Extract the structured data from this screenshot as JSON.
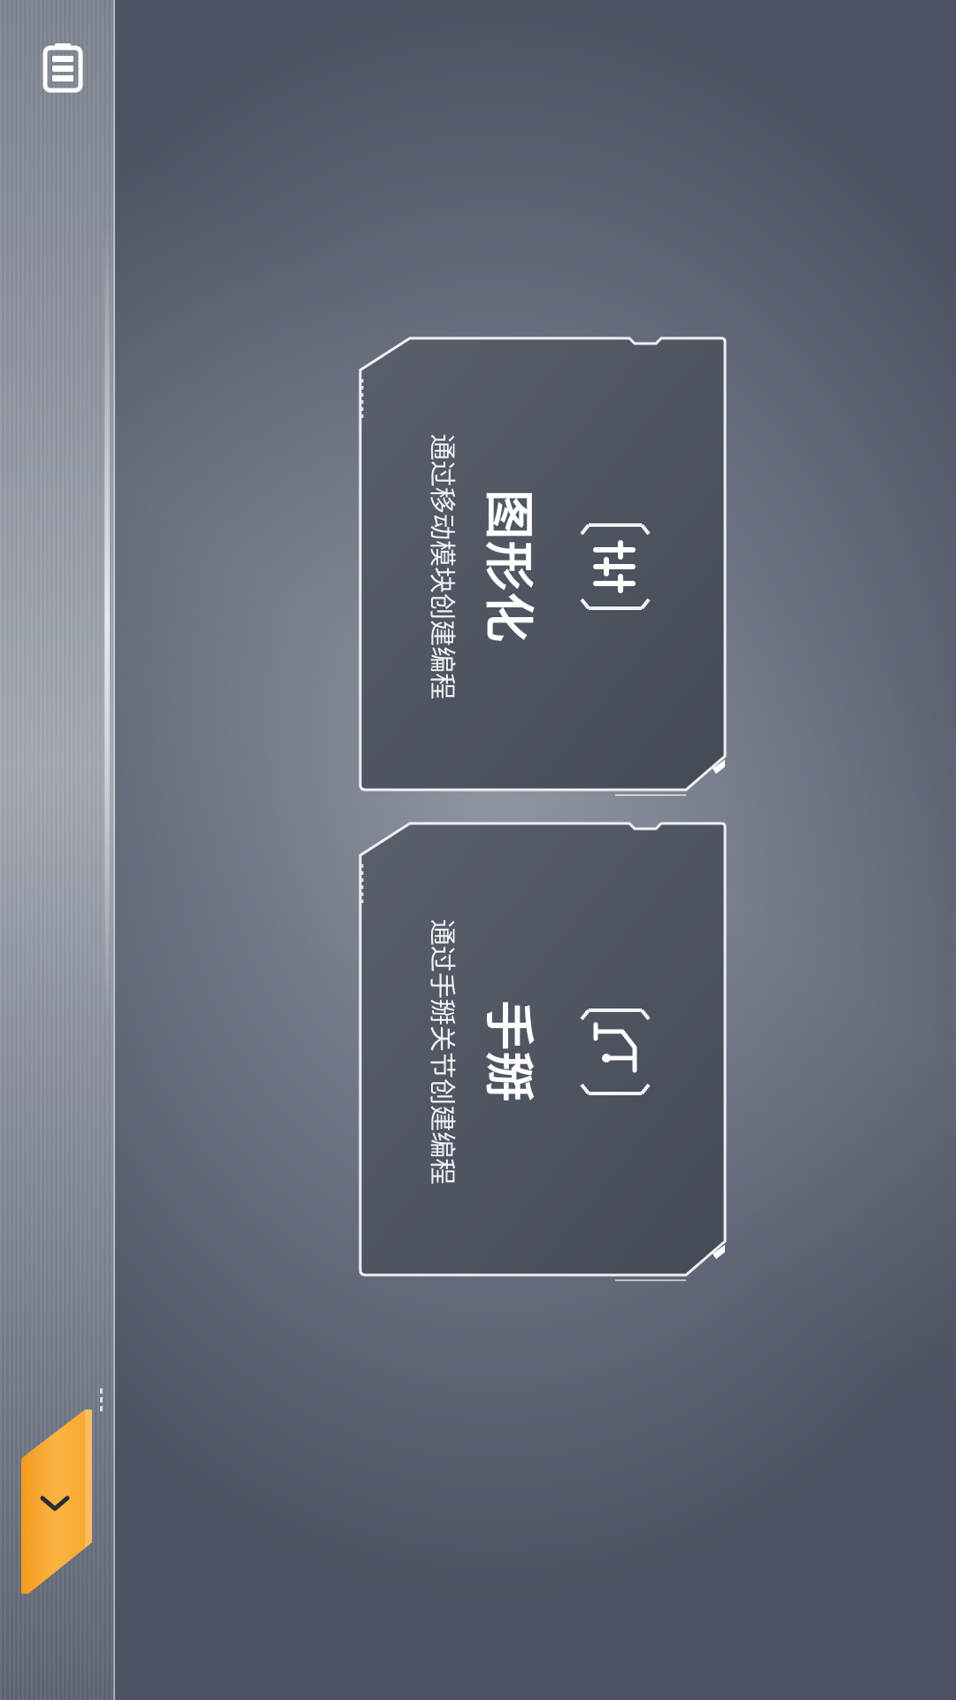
{
  "cards": [
    {
      "title": "图形化",
      "subtitle": "通过移动模块创建编程",
      "icon": "sliders-icon"
    },
    {
      "title": "手掰",
      "subtitle": "通过手掰关节创建编程",
      "icon": "robot-arm-icon"
    }
  ],
  "sidebar": {
    "top_icon": "battery-icon",
    "collapse_icon": "chevron-down-icon"
  },
  "colors": {
    "accent": "#f5a623",
    "card_bg": "#4f5462",
    "card_border": "#e6e8ee"
  }
}
